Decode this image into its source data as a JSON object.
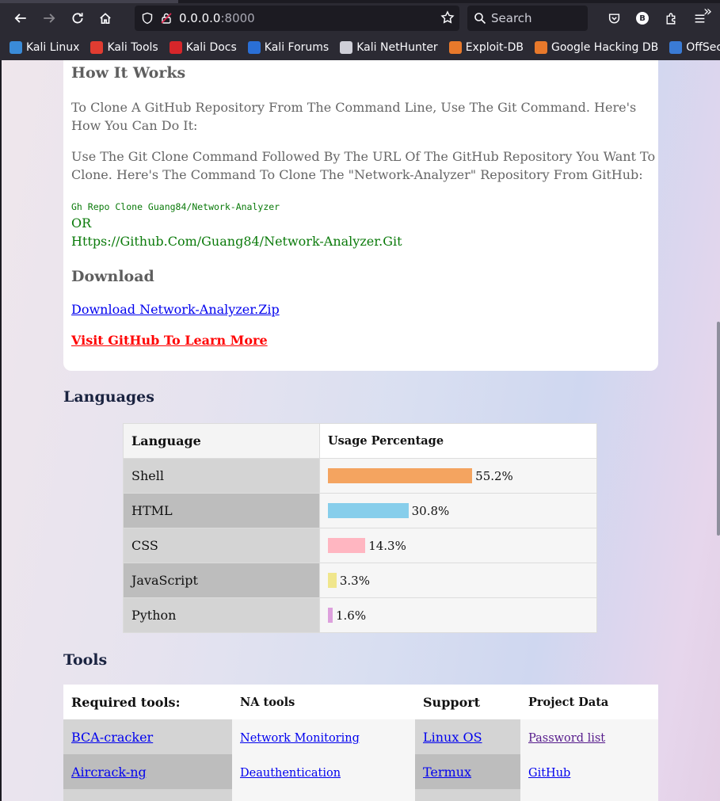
{
  "browser": {
    "url_host": "0.0.0.0",
    "url_port": ":8000",
    "search_placeholder": "Search",
    "avatar_initial": "B",
    "bookmarks": [
      {
        "label": "Kali Linux",
        "color": "#3a8bd8"
      },
      {
        "label": "Kali Tools",
        "color": "#e03c31"
      },
      {
        "label": "Kali Docs",
        "color": "#d6262a"
      },
      {
        "label": "Kali Forums",
        "color": "#2a6fd6"
      },
      {
        "label": "Kali NetHunter",
        "color": "#cfcfd8"
      },
      {
        "label": "Exploit-DB",
        "color": "#e8792b"
      },
      {
        "label": "Google Hacking DB",
        "color": "#e8792b"
      },
      {
        "label": "OffSec",
        "color": "#3a7bd5"
      }
    ]
  },
  "how_it_works": {
    "heading": "How It Works",
    "para1": "To Clone A GitHub Repository From The Command Line, Use The Git Command. Here's How You Can Do It:",
    "para2": "Use The Git Clone Command Followed By The URL Of The GitHub Repository You Want To Clone. Here's The Command To Clone The \"Network-Analyzer\" Repository From GitHub:",
    "command": "Gh Repo Clone Guang84/Network-Analyzer",
    "or": "OR",
    "url": "Https://Github.Com/Guang84/Network-Analyzer.Git"
  },
  "download": {
    "heading": "Download",
    "zip_link": "Download Network-Analyzer.Zip",
    "github_link": "Visit GitHub To Learn More"
  },
  "languages": {
    "heading": "Languages",
    "col_language": "Language",
    "col_usage": "Usage Percentage",
    "rows": [
      {
        "name": "Shell",
        "percent": 55.2,
        "label": "55.2%",
        "color": "#f4a460"
      },
      {
        "name": "HTML",
        "percent": 30.8,
        "label": "30.8%",
        "color": "#87ceeb"
      },
      {
        "name": "CSS",
        "percent": 14.3,
        "label": "14.3%",
        "color": "#ffb6c1"
      },
      {
        "name": "JavaScript",
        "percent": 3.3,
        "label": "3.3%",
        "color": "#f0e68c"
      },
      {
        "name": "Python",
        "percent": 1.6,
        "label": "1.6%",
        "color": "#dda0dd"
      }
    ]
  },
  "tools": {
    "heading": "Tools",
    "headers": {
      "required": "Required tools:",
      "na": "NA tools",
      "support": "Support",
      "project": "Project Data"
    },
    "rows": [
      {
        "required": "BCA-cracker",
        "na": "Network Monitoring",
        "support": "Linux OS",
        "project": "Password list"
      },
      {
        "required": "Aircrack-ng",
        "na": "Deauthentication",
        "support": "Termux",
        "project": "GitHub"
      }
    ]
  }
}
